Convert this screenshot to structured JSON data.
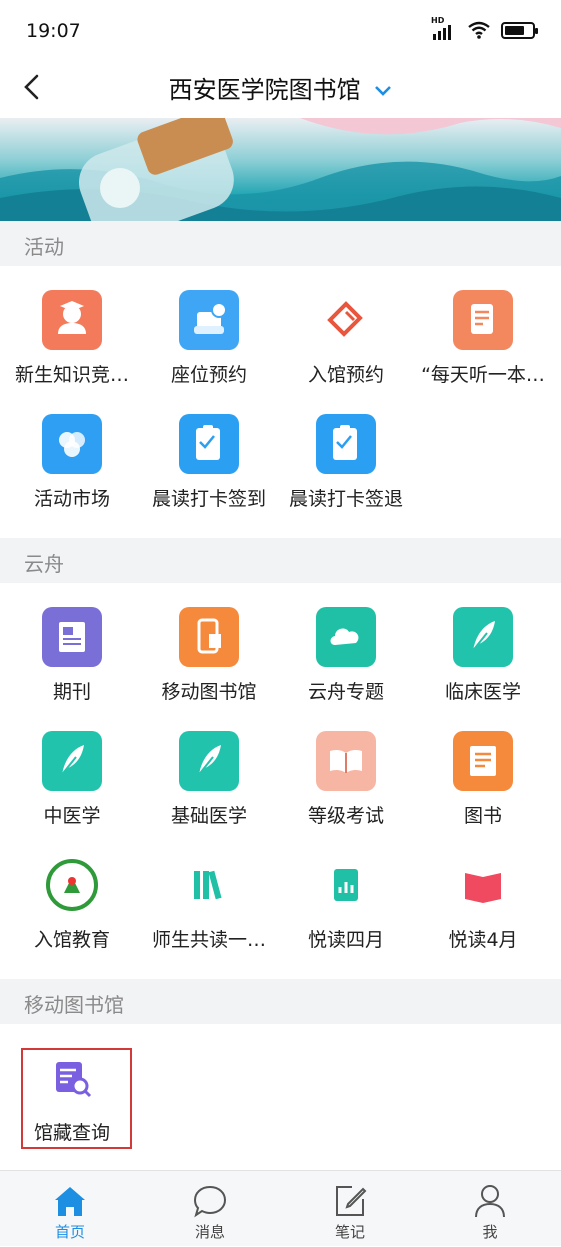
{
  "status_bar": {
    "time": "19:07",
    "network": "HD",
    "battery_level": 0.72
  },
  "nav": {
    "title": "西安医学院图书馆"
  },
  "sections": [
    {
      "title": "活动"
    },
    {
      "title": "云舟"
    },
    {
      "title": "移动图书馆"
    }
  ],
  "activities": [
    {
      "label": "新生知识竞…",
      "icon": "graduate-icon",
      "color": "#f37a5b"
    },
    {
      "label": "座位预约",
      "icon": "seat-icon",
      "color": "#3fa6f5"
    },
    {
      "label": "入馆预约",
      "icon": "ticket-icon",
      "color": "#e9553d"
    },
    {
      "label": "“每天听一本…",
      "icon": "note-icon",
      "color": "#f3875e"
    },
    {
      "label": "活动市场",
      "icon": "circles-icon",
      "color": "#2e9ff2"
    },
    {
      "label": "晨读打卡签到",
      "icon": "clipboard-icon",
      "color": "#2b9ff2"
    },
    {
      "label": "晨读打卡签退",
      "icon": "clipboard-icon",
      "color": "#2b9ff2"
    }
  ],
  "yunzhou": [
    {
      "label": "期刊",
      "icon": "journal-icon",
      "color": "#7a6fd6"
    },
    {
      "label": "移动图书馆",
      "icon": "mobile-library-icon",
      "color": "#f58a3c"
    },
    {
      "label": "云舟专题",
      "icon": "cloud-icon",
      "color": "#1fc0a6"
    },
    {
      "label": "临床医学",
      "icon": "feather-icon",
      "color": "#22c3ad"
    },
    {
      "label": "中医学",
      "icon": "feather-icon",
      "color": "#22c3ad"
    },
    {
      "label": "基础医学",
      "icon": "feather-icon",
      "color": "#22c3ad"
    },
    {
      "label": "等级考试",
      "icon": "open-book-icon",
      "color": "#f6b6a3"
    },
    {
      "label": "图书",
      "icon": "book-icon",
      "color": "#f58a3c"
    },
    {
      "label": "入馆教育",
      "icon": "school-emblem-icon",
      "color": "#2f9a3a"
    },
    {
      "label": "师生共读一…",
      "icon": "books-shelf-icon",
      "color": "#1fc0a6"
    },
    {
      "label": "悦读四月",
      "icon": "chart-book-icon",
      "color": "#1fc0a6"
    },
    {
      "label": "悦读4月",
      "icon": "red-book-icon",
      "color": "#ef4a5f"
    }
  ],
  "mobile_library": [
    {
      "label": "馆藏查询",
      "icon": "catalog-search-icon",
      "color": "#7a5fe0"
    }
  ],
  "tabs": [
    {
      "label": "首页",
      "icon": "home-icon"
    },
    {
      "label": "消息",
      "icon": "message-icon"
    },
    {
      "label": "笔记",
      "icon": "note-edit-icon"
    },
    {
      "label": "我",
      "icon": "profile-icon"
    }
  ],
  "colors": {
    "accent": "#1c8fe3",
    "highlight_box": "#d23a3a",
    "section_bg": "#f2f3f5"
  }
}
